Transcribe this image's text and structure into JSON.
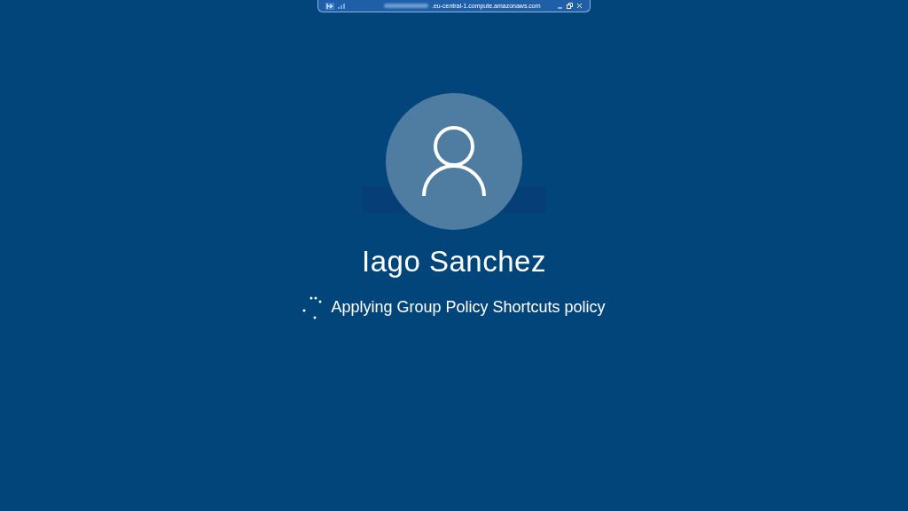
{
  "connection_bar": {
    "host": ".eu-central-1.compute.amazonaws.com"
  },
  "user": {
    "name": "Iago Sanchez"
  },
  "status": {
    "message": "Applying Group Policy Shortcuts policy"
  }
}
